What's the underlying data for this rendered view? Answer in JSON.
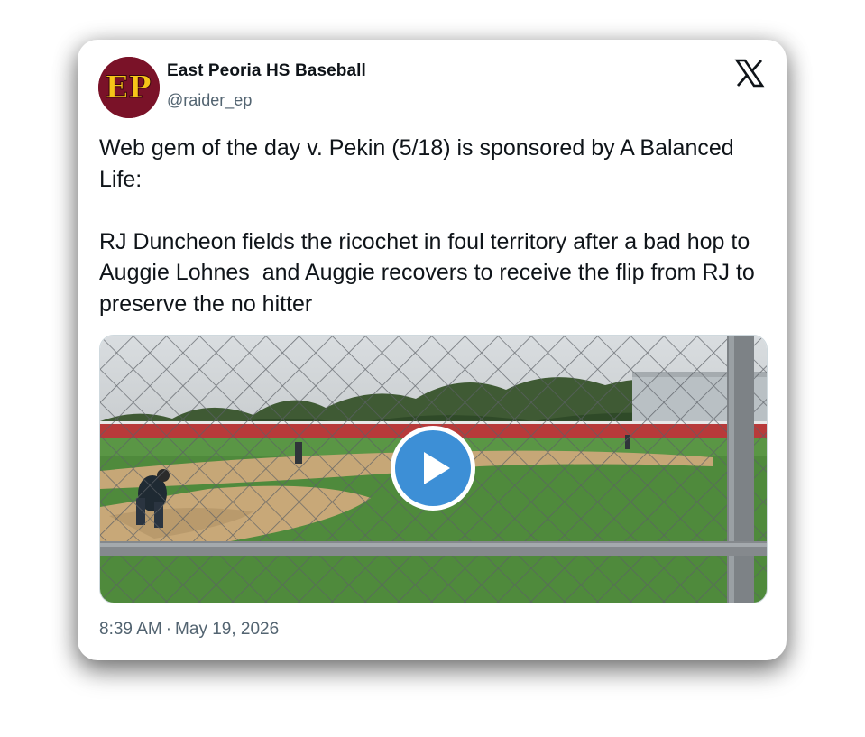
{
  "account": {
    "name": "East Peoria HS Baseball",
    "handle": "@raider_ep",
    "avatar_text": "EP",
    "avatar_color": "#7a1228",
    "avatar_letter_color": "#f5c518"
  },
  "platform": {
    "logo_icon": "x-logo-icon"
  },
  "tweet": {
    "text": "Web gem of the day v. Pekin (5/18) is sponsored by A Balanced Life:\n\nRJ Duncheon fields the ricochet in foul territory after a bad hop to Auggie Lohnes  and Auggie recovers to receive the flip from RJ to preserve the no hitter"
  },
  "media": {
    "type": "video",
    "play_icon": "play-icon",
    "play_color": "#3d8fd6"
  },
  "meta": {
    "time": "8:39 AM",
    "separator": "·",
    "date": "May 19, 2026"
  }
}
